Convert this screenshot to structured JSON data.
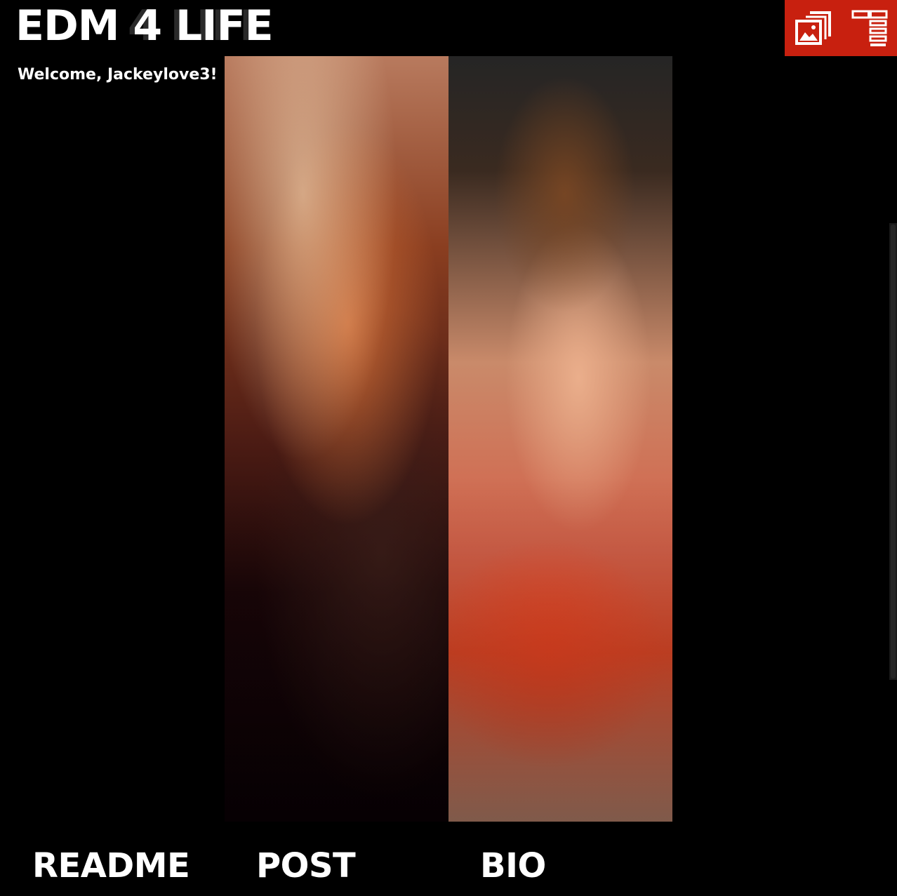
{
  "header": {
    "logo_ghost": "4 LIFE",
    "logo": "EDM 4 LIFE",
    "welcome": "Welcome, Jackeylove3!"
  },
  "toolbar": {
    "accent_color": "#c8200f",
    "buttons": [
      {
        "icon": "picture-icon"
      },
      {
        "icon": "list-menu-icon"
      }
    ]
  },
  "panels": [
    {
      "name": "artist-photo-female"
    },
    {
      "name": "artist-photo-male"
    }
  ],
  "nav": {
    "readme": "README",
    "post": "POST",
    "bio": "BIO"
  }
}
